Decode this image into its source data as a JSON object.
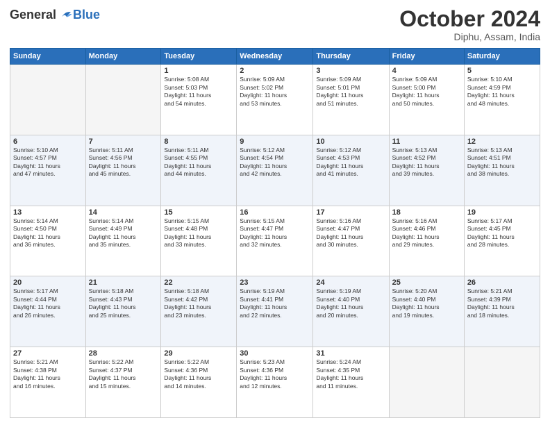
{
  "header": {
    "logo_general": "General",
    "logo_blue": "Blue",
    "month_title": "October 2024",
    "location": "Diphu, Assam, India"
  },
  "days_of_week": [
    "Sunday",
    "Monday",
    "Tuesday",
    "Wednesday",
    "Thursday",
    "Friday",
    "Saturday"
  ],
  "weeks": [
    {
      "shade": false,
      "days": [
        {
          "num": "",
          "detail": ""
        },
        {
          "num": "",
          "detail": ""
        },
        {
          "num": "1",
          "detail": "Sunrise: 5:08 AM\nSunset: 5:03 PM\nDaylight: 11 hours\nand 54 minutes."
        },
        {
          "num": "2",
          "detail": "Sunrise: 5:09 AM\nSunset: 5:02 PM\nDaylight: 11 hours\nand 53 minutes."
        },
        {
          "num": "3",
          "detail": "Sunrise: 5:09 AM\nSunset: 5:01 PM\nDaylight: 11 hours\nand 51 minutes."
        },
        {
          "num": "4",
          "detail": "Sunrise: 5:09 AM\nSunset: 5:00 PM\nDaylight: 11 hours\nand 50 minutes."
        },
        {
          "num": "5",
          "detail": "Sunrise: 5:10 AM\nSunset: 4:59 PM\nDaylight: 11 hours\nand 48 minutes."
        }
      ]
    },
    {
      "shade": true,
      "days": [
        {
          "num": "6",
          "detail": "Sunrise: 5:10 AM\nSunset: 4:57 PM\nDaylight: 11 hours\nand 47 minutes."
        },
        {
          "num": "7",
          "detail": "Sunrise: 5:11 AM\nSunset: 4:56 PM\nDaylight: 11 hours\nand 45 minutes."
        },
        {
          "num": "8",
          "detail": "Sunrise: 5:11 AM\nSunset: 4:55 PM\nDaylight: 11 hours\nand 44 minutes."
        },
        {
          "num": "9",
          "detail": "Sunrise: 5:12 AM\nSunset: 4:54 PM\nDaylight: 11 hours\nand 42 minutes."
        },
        {
          "num": "10",
          "detail": "Sunrise: 5:12 AM\nSunset: 4:53 PM\nDaylight: 11 hours\nand 41 minutes."
        },
        {
          "num": "11",
          "detail": "Sunrise: 5:13 AM\nSunset: 4:52 PM\nDaylight: 11 hours\nand 39 minutes."
        },
        {
          "num": "12",
          "detail": "Sunrise: 5:13 AM\nSunset: 4:51 PM\nDaylight: 11 hours\nand 38 minutes."
        }
      ]
    },
    {
      "shade": false,
      "days": [
        {
          "num": "13",
          "detail": "Sunrise: 5:14 AM\nSunset: 4:50 PM\nDaylight: 11 hours\nand 36 minutes."
        },
        {
          "num": "14",
          "detail": "Sunrise: 5:14 AM\nSunset: 4:49 PM\nDaylight: 11 hours\nand 35 minutes."
        },
        {
          "num": "15",
          "detail": "Sunrise: 5:15 AM\nSunset: 4:48 PM\nDaylight: 11 hours\nand 33 minutes."
        },
        {
          "num": "16",
          "detail": "Sunrise: 5:15 AM\nSunset: 4:47 PM\nDaylight: 11 hours\nand 32 minutes."
        },
        {
          "num": "17",
          "detail": "Sunrise: 5:16 AM\nSunset: 4:47 PM\nDaylight: 11 hours\nand 30 minutes."
        },
        {
          "num": "18",
          "detail": "Sunrise: 5:16 AM\nSunset: 4:46 PM\nDaylight: 11 hours\nand 29 minutes."
        },
        {
          "num": "19",
          "detail": "Sunrise: 5:17 AM\nSunset: 4:45 PM\nDaylight: 11 hours\nand 28 minutes."
        }
      ]
    },
    {
      "shade": true,
      "days": [
        {
          "num": "20",
          "detail": "Sunrise: 5:17 AM\nSunset: 4:44 PM\nDaylight: 11 hours\nand 26 minutes."
        },
        {
          "num": "21",
          "detail": "Sunrise: 5:18 AM\nSunset: 4:43 PM\nDaylight: 11 hours\nand 25 minutes."
        },
        {
          "num": "22",
          "detail": "Sunrise: 5:18 AM\nSunset: 4:42 PM\nDaylight: 11 hours\nand 23 minutes."
        },
        {
          "num": "23",
          "detail": "Sunrise: 5:19 AM\nSunset: 4:41 PM\nDaylight: 11 hours\nand 22 minutes."
        },
        {
          "num": "24",
          "detail": "Sunrise: 5:19 AM\nSunset: 4:40 PM\nDaylight: 11 hours\nand 20 minutes."
        },
        {
          "num": "25",
          "detail": "Sunrise: 5:20 AM\nSunset: 4:40 PM\nDaylight: 11 hours\nand 19 minutes."
        },
        {
          "num": "26",
          "detail": "Sunrise: 5:21 AM\nSunset: 4:39 PM\nDaylight: 11 hours\nand 18 minutes."
        }
      ]
    },
    {
      "shade": false,
      "days": [
        {
          "num": "27",
          "detail": "Sunrise: 5:21 AM\nSunset: 4:38 PM\nDaylight: 11 hours\nand 16 minutes."
        },
        {
          "num": "28",
          "detail": "Sunrise: 5:22 AM\nSunset: 4:37 PM\nDaylight: 11 hours\nand 15 minutes."
        },
        {
          "num": "29",
          "detail": "Sunrise: 5:22 AM\nSunset: 4:36 PM\nDaylight: 11 hours\nand 14 minutes."
        },
        {
          "num": "30",
          "detail": "Sunrise: 5:23 AM\nSunset: 4:36 PM\nDaylight: 11 hours\nand 12 minutes."
        },
        {
          "num": "31",
          "detail": "Sunrise: 5:24 AM\nSunset: 4:35 PM\nDaylight: 11 hours\nand 11 minutes."
        },
        {
          "num": "",
          "detail": ""
        },
        {
          "num": "",
          "detail": ""
        }
      ]
    }
  ]
}
